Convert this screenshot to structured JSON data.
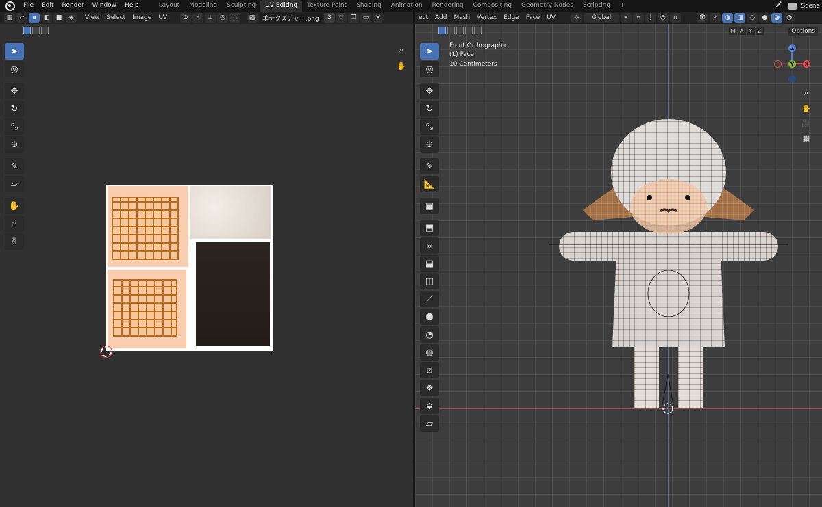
{
  "topbar": {
    "menus": [
      "File",
      "Edit",
      "Render",
      "Window",
      "Help"
    ],
    "workspaces": [
      "Layout",
      "Modeling",
      "Sculpting",
      "UV Editing",
      "Texture Paint",
      "Shading",
      "Animation",
      "Rendering",
      "Compositing",
      "Geometry Nodes",
      "Scripting"
    ],
    "active_workspace": "UV Editing",
    "scene_name": "Scene"
  },
  "uv_editor": {
    "menus": [
      "View",
      "Select",
      "Image",
      "UV"
    ],
    "image_name": "羊テクスチャー.png",
    "image_users": "3",
    "tools": [
      "select-box",
      "cursor",
      "move",
      "rotate",
      "scale",
      "transform",
      "annotate",
      "rip-region",
      "grab",
      "relax",
      "pinch"
    ]
  },
  "viewport": {
    "menus": [
      "ect",
      "Add",
      "Mesh",
      "Vertex",
      "Edge",
      "Face",
      "UV"
    ],
    "orientation": "Global",
    "view_name": "Front Orthographic",
    "object_info": "(1) Face",
    "scale_info": "10 Centimeters",
    "axis_buttons": [
      "X",
      "Y",
      "Z"
    ],
    "options_label": "Options",
    "gizmo": {
      "x": "X",
      "y": "Y",
      "z": "Z"
    },
    "colors": {
      "x_axis": "#d94a4a",
      "y_axis": "#80b03a",
      "z_axis": "#4d7dd6",
      "selection": "#f28a1e"
    }
  }
}
